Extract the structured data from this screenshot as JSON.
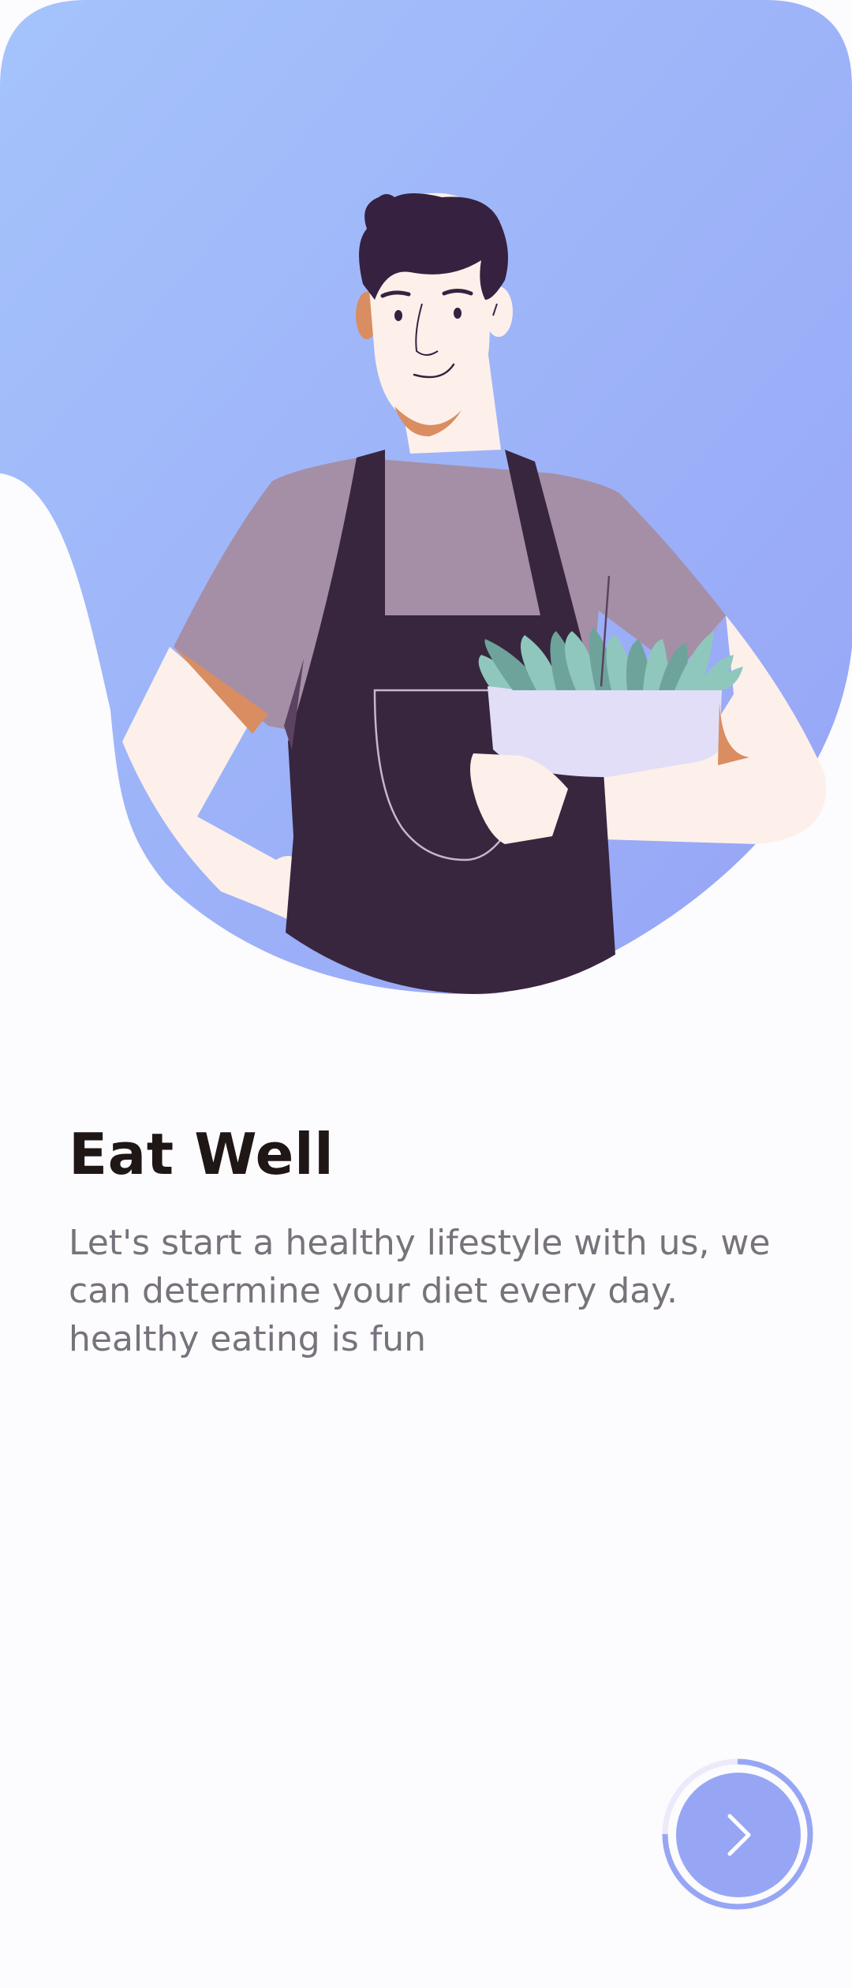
{
  "onboarding": {
    "title": "Eat Well",
    "description": "Let's start a healthy lifestyle with us, we can determine your diet every day. healthy eating is fun",
    "progress": 0.75
  },
  "icons": {
    "next": "chevron-right-icon",
    "illustration": "chef-with-salad-bowl"
  },
  "colors": {
    "accent": "#97a6f4",
    "gradient_start": "#a5c3fb",
    "gradient_end": "#96a4f6",
    "title": "#1f1616",
    "body_text": "#77727b",
    "background": "#fcfbfd"
  }
}
